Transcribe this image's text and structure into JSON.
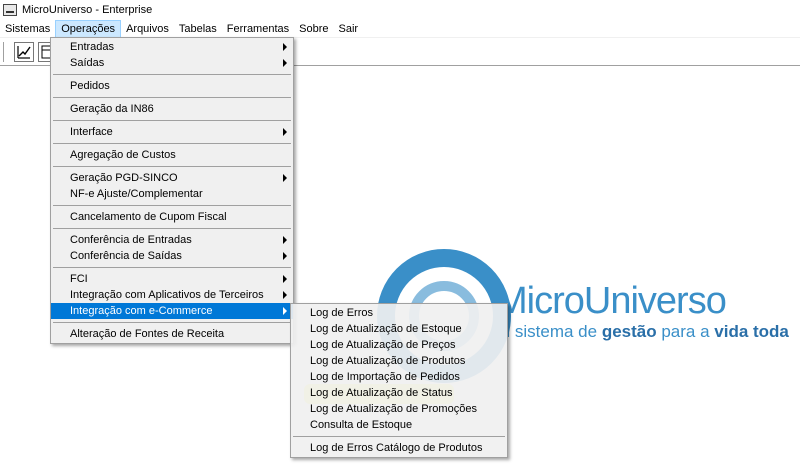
{
  "window": {
    "title": "MicroUniverso - Enterprise"
  },
  "menubar": [
    {
      "label": "Sistemas",
      "key": "S"
    },
    {
      "label": "Operações",
      "key": "O"
    },
    {
      "label": "Arquivos",
      "key": "A"
    },
    {
      "label": "Tabelas",
      "key": "T"
    },
    {
      "label": "Ferramentas",
      "key": "F"
    },
    {
      "label": "Sobre",
      "key": "b"
    },
    {
      "label": "Sair",
      "key": "S"
    }
  ],
  "operacoes_menu": {
    "entradas": "Entradas",
    "saidas": "Saídas",
    "pedidos": "Pedidos",
    "geracao_in86": "Geração da IN86",
    "interface": "Interface",
    "agregacao_custos": "Agregação de Custos",
    "geracao_pgd": "Geração PGD-SINCO",
    "nfe_ajuste": "NF-e Ajuste/Complementar",
    "cancelamento_cupom": "Cancelamento de Cupom Fiscal",
    "conferencia_entradas": "Conferência de Entradas",
    "conferencia_saidas": "Conferência de Saídas",
    "fci": "FCI",
    "integracao_aplicativos": "Integração com Aplicativos de Terceiros",
    "integracao_ecommerce": "Integração com e-Commerce",
    "alteracao_fontes": "Alteração de Fontes de Receita"
  },
  "ecommerce_submenu": {
    "log_erros": "Log de Erros",
    "log_estoque": "Log de Atualização de Estoque",
    "log_precos": "Log de Atualização de Preços",
    "log_produtos": "Log de Atualização de Produtos",
    "log_importacao": "Log de Importação de Pedidos",
    "log_status": "Log de Atualização de Status",
    "log_promocoes": "Log de Atualização de Promoções",
    "consulta_estoque": "Consulta de Estoque",
    "log_catalogo": "Log de Erros Catálogo de Produtos"
  },
  "logo": {
    "name": "MicroUniverso",
    "tagline_pre": "m sistema de ",
    "tagline_bold1": "gestão",
    "tagline_mid": " para a ",
    "tagline_bold2": "vida toda"
  },
  "colors": {
    "accent": "#0078d7",
    "logo": "#3a8fc8",
    "highlight": "#ffff55"
  }
}
